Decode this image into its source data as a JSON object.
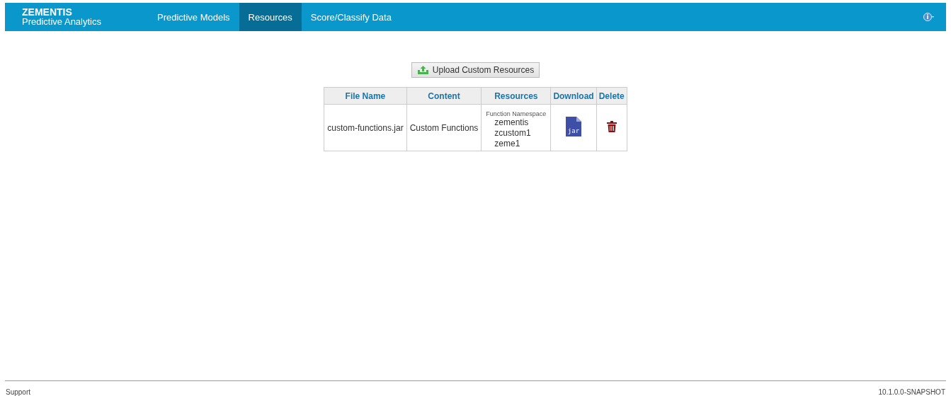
{
  "brand": {
    "title": "ZEMENTIS",
    "subtitle": "Predictive Analytics"
  },
  "nav": [
    {
      "label": "Predictive Models",
      "selected": false
    },
    {
      "label": "Resources",
      "selected": true
    },
    {
      "label": "Score/Classify Data",
      "selected": false
    }
  ],
  "upload_button": "Upload Custom Resources",
  "table": {
    "columns": [
      "File Name",
      "Content",
      "Resources",
      "Download",
      "Delete"
    ],
    "rows": [
      {
        "file_name": "custom-functions.jar",
        "content": "Custom Functions",
        "resources_label": "Function Namespace",
        "namespaces": [
          "zementis",
          "zcustom1",
          "zeme1"
        ],
        "download_icon_label": "jar"
      }
    ]
  },
  "footer": {
    "link": "Support",
    "version": "10.1.0.0-SNAPSHOT"
  }
}
